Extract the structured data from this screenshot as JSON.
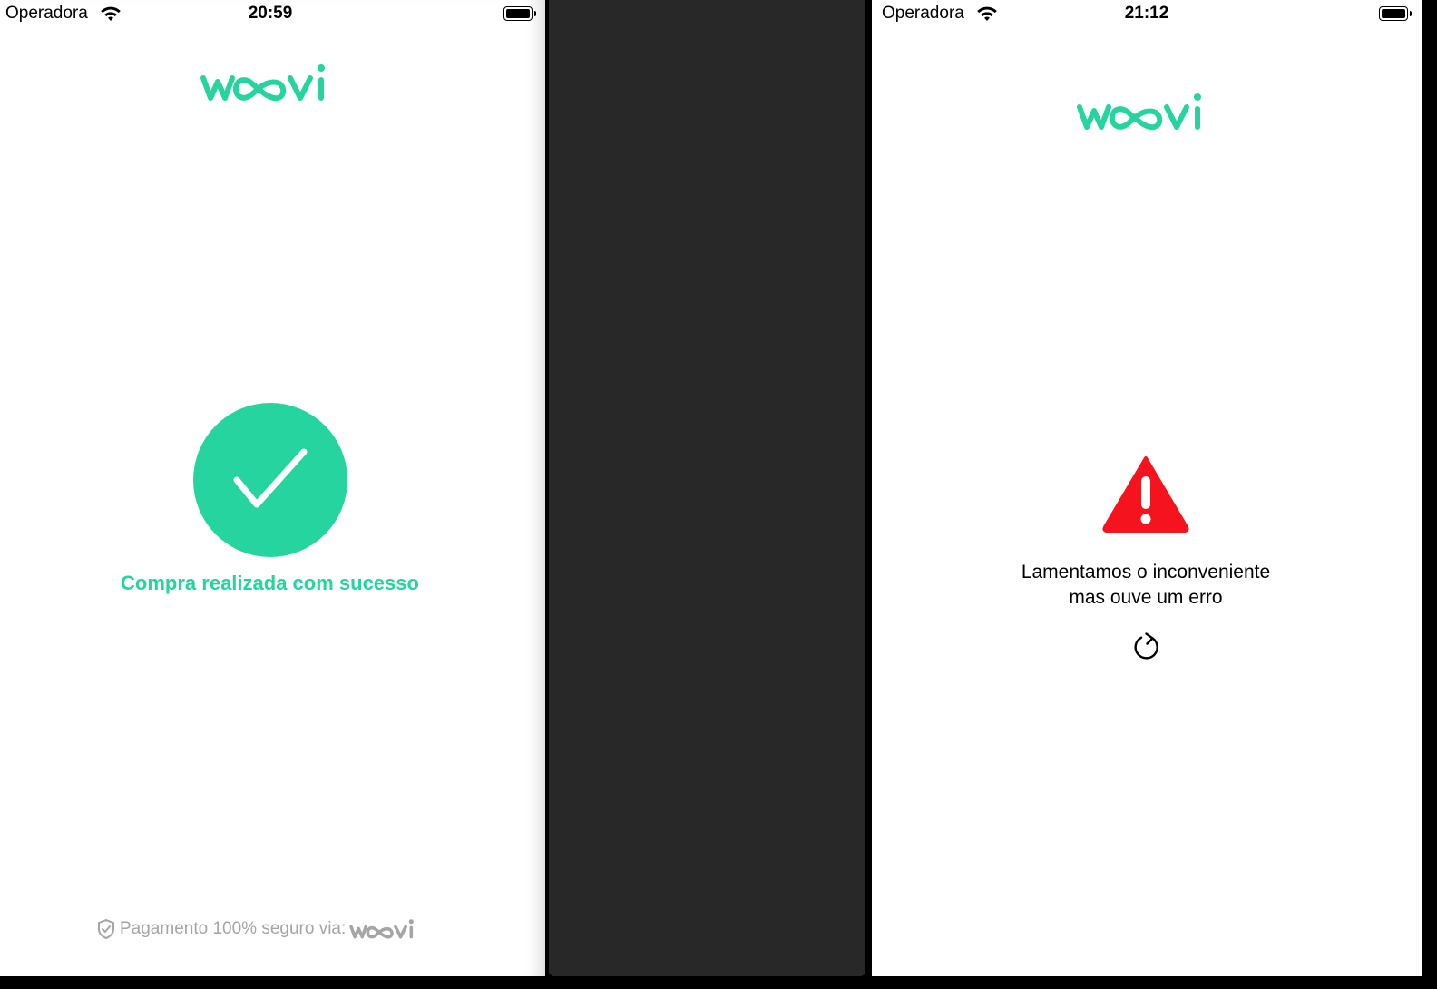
{
  "colors": {
    "brand": "#25d49e",
    "error": "#f5141e",
    "muted": "#a5a5a5"
  },
  "left_screen": {
    "status": {
      "carrier": "Operadora",
      "time": "20:59"
    },
    "logo_icon": "woovi-logo",
    "success_icon": "check-circle-icon",
    "success_message": "Compra realizada com sucesso",
    "footer": {
      "icon": "shield-check-icon",
      "text": "Pagamento 100% seguro via:",
      "logo_icon": "woovi-logo"
    }
  },
  "right_screen": {
    "status": {
      "carrier": "Operadora",
      "time": "21:12"
    },
    "logo_icon": "woovi-logo",
    "error_icon": "warning-triangle-icon",
    "error_message_line1": "Lamentamos o inconveniente",
    "error_message_line2": "mas ouve um erro",
    "retry_icon": "refresh-icon"
  }
}
